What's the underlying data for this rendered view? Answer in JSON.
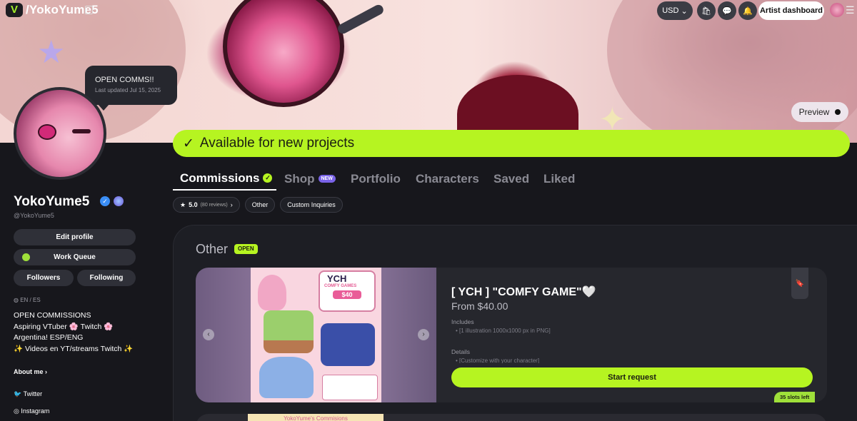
{
  "topbar": {
    "handle": "/YokoYume5",
    "currency": "USD",
    "currency_caret": "⌄",
    "artist_dashboard": "Artist dashboard",
    "icons": [
      "logo-icon",
      "copy-icon",
      "cart-icon",
      "chat-icon",
      "bell-icon",
      "user-avatar",
      "menu-icon"
    ]
  },
  "banner": {
    "preview": "Preview",
    "available": "Available for new projects",
    "available_check": "✓"
  },
  "status_bubble": {
    "title": "OPEN COMMS!!",
    "updated": "Last updated Jul 15, 2025"
  },
  "profile": {
    "name": "YokoYume5",
    "at": "@YokoYume5",
    "edit_profile": "Edit profile",
    "work_queue": "Work Queue",
    "followers": "Followers",
    "following": "Following",
    "languages": "EN / ES",
    "bio": [
      "OPEN COMMISSIONS",
      " Aspiring VTuber 🌸 Twitch 🌸",
      "Argentina! ESP/ENG",
      "✨ Videos en YT/streams Twitch ✨"
    ],
    "about_me": "About me",
    "socials": [
      "Twitter",
      "Instagram"
    ]
  },
  "tabs": [
    {
      "label": "Commissions",
      "active": true
    },
    {
      "label": "Shop",
      "badge": "NEW"
    },
    {
      "label": "Portfolio"
    },
    {
      "label": "Characters"
    },
    {
      "label": "Saved"
    },
    {
      "label": "Liked"
    }
  ],
  "filters": {
    "rating": "5.0",
    "reviews": "(80 reviews)",
    "chips": [
      "Other",
      "Custom Inquiries"
    ]
  },
  "section": {
    "title": "Other",
    "badge": "OPEN"
  },
  "card": {
    "art_title": "YCH",
    "art_subtitle": "COMFY GAMES",
    "art_price": "$40",
    "title": "[ YCH ] \"COMFY GAME\"🤍",
    "price": "From $40.00",
    "includes_label": "Includes",
    "includes_item": "[1 illustration 1000x1000 px in PNG]",
    "details_label": "Details",
    "details_item": "[Customize with your character]",
    "start_request": "Start request",
    "slots": "35 slots left"
  },
  "card2": {
    "peek_title": "YokoYume's Commisions"
  }
}
